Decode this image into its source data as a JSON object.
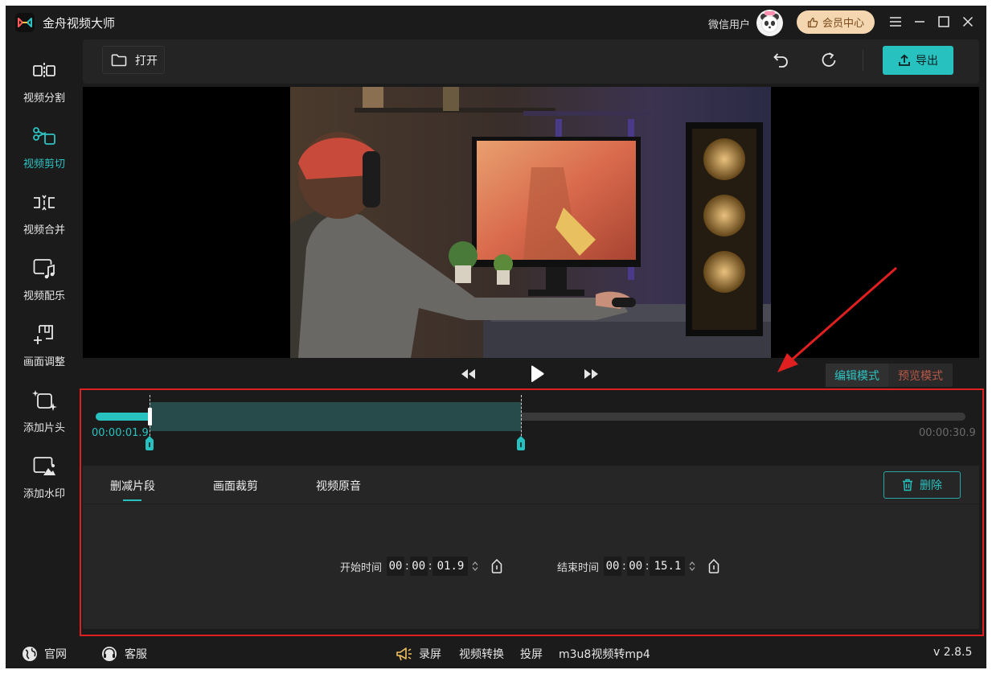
{
  "app": {
    "title": "金舟视频大师"
  },
  "header": {
    "user_name": "微信用户",
    "vip_label": "会员中心"
  },
  "sidebar": {
    "items": [
      {
        "label": "视频分割",
        "icon": "split-icon",
        "active": false
      },
      {
        "label": "视频剪切",
        "icon": "scissors-icon",
        "active": true
      },
      {
        "label": "视频合并",
        "icon": "merge-icon",
        "active": false
      },
      {
        "label": "视频配乐",
        "icon": "music-icon",
        "active": false
      },
      {
        "label": "画面调整",
        "icon": "crop-icon",
        "active": false
      },
      {
        "label": "添加片头",
        "icon": "sparkle-icon",
        "active": false
      },
      {
        "label": "添加水印",
        "icon": "image-icon",
        "active": false
      }
    ]
  },
  "toolbar": {
    "open_label": "打开",
    "export_label": "导出"
  },
  "playback": {
    "mode_edit": "编辑模式",
    "mode_preview": "预览模式"
  },
  "timeline": {
    "current_time": "00:00:01.9",
    "total_time": "00:00:30.9",
    "played_fraction": 0.062,
    "selection_start_fraction": 0.062,
    "selection_end_fraction": 0.489
  },
  "edit_panel": {
    "tabs": [
      "删减片段",
      "画面裁剪",
      "视频原音"
    ],
    "active_tab": 0,
    "delete_label": "删除",
    "start": {
      "label": "开始时间",
      "hh": "00",
      "mm": "00",
      "ss": "01.9"
    },
    "end": {
      "label": "结束时间",
      "hh": "00",
      "mm": "00",
      "ss": "15.1"
    }
  },
  "statusbar": {
    "website": "官网",
    "support": "客服",
    "links": [
      "录屏",
      "视频转换",
      "投屏",
      "m3u8视频转mp4"
    ],
    "version": "v 2.8.5"
  },
  "colors": {
    "accent": "#27c2c0",
    "background": "#1b1b1b",
    "panel": "#262626",
    "annotation": "#e02020"
  }
}
